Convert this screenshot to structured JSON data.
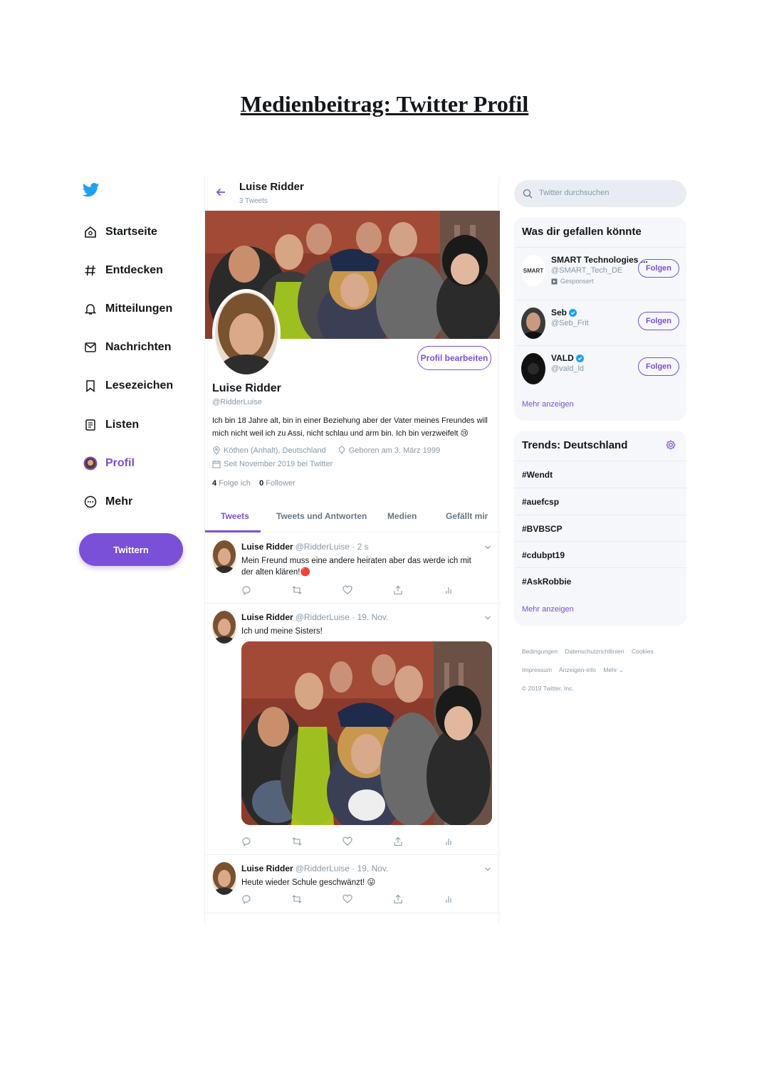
{
  "document": {
    "title": "Medienbeitrag: Twitter Profil"
  },
  "colors": {
    "accent": "#7b50d8",
    "twitter_blue": "#1da1f2",
    "muted": "#8899a6"
  },
  "sidebar": {
    "logo": "twitter-bird-icon",
    "items": [
      {
        "label": "Startseite",
        "icon": "home-icon"
      },
      {
        "label": "Entdecken",
        "icon": "hashtag-icon"
      },
      {
        "label": "Mitteilungen",
        "icon": "bell-icon"
      },
      {
        "label": "Nachrichten",
        "icon": "mail-icon"
      },
      {
        "label": "Lesezeichen",
        "icon": "bookmark-icon"
      },
      {
        "label": "Listen",
        "icon": "list-icon"
      },
      {
        "label": "Profil",
        "icon": "profile-avatar-icon",
        "active": true
      },
      {
        "label": "Mehr",
        "icon": "more-circle-icon"
      }
    ],
    "tweet_button": "Twittern"
  },
  "header": {
    "name": "Luise Ridder",
    "tweet_count": "3 Tweets"
  },
  "profile": {
    "name": "Luise Ridder",
    "handle": "@RidderLuise",
    "edit_button": "Profil bearbeiten",
    "bio": "Ich bin 18 Jahre alt, bin in einer Beziehung aber der Vater meines Freundes will mich nicht weil ich zu Assi, nicht schlau und arm bin. Ich bin verzweifelt 😢",
    "location": "Köthen (Anhalt), Deutschland",
    "birthday": "Geboren am 3. März 1999",
    "joined": "Seit November 2019 bei Twitter",
    "following_count": "4",
    "following_label": "Folge ich",
    "followers_count": "0",
    "followers_label": "Follower"
  },
  "tabs": [
    {
      "label": "Tweets",
      "active": true
    },
    {
      "label": "Tweets und Antworten"
    },
    {
      "label": "Medien"
    },
    {
      "label": "Gefällt mir"
    }
  ],
  "tweets": [
    {
      "name": "Luise Ridder",
      "meta": "@RidderLuise · 2 s",
      "text": "Mein Freund muss eine andere heiraten aber das werde ich mit der alten klären!🔴"
    },
    {
      "name": "Luise Ridder",
      "meta": "@RidderLuise · 19. Nov.",
      "text": "Ich und meine Sisters!",
      "has_media": true
    },
    {
      "name": "Luise Ridder",
      "meta": "@RidderLuise · 19. Nov.",
      "text": "Heute wieder Schule geschwänzt! 😛"
    }
  ],
  "search": {
    "placeholder": "Twitter durchsuchen"
  },
  "suggestions": {
    "title": "Was dir gefallen könnte",
    "items": [
      {
        "name": "SMART Technologies ...",
        "handle": "@SMART_Tech_DE",
        "sponsored": "Gesponsert",
        "button": "Folgen",
        "avatar_text": "SMART"
      },
      {
        "name": "Seb",
        "handle": "@Seb_Frit",
        "verified": true,
        "button": "Folgen"
      },
      {
        "name": "VALD",
        "handle": "@vald_ld",
        "verified": true,
        "button": "Folgen"
      }
    ],
    "more": "Mehr anzeigen"
  },
  "trends": {
    "title": "Trends: Deutschland",
    "items": [
      "#Wendt",
      "#auefcsp",
      "#BVBSCP",
      "#cdubpt19",
      "#AskRobbie"
    ],
    "more": "Mehr anzeigen"
  },
  "footer": {
    "links_row1": [
      "Bedingungen",
      "Datenschutzrichtlinien",
      "Cookies"
    ],
    "links_row2": [
      "Impressum",
      "Anzeigen-info",
      "Mehr ⌄"
    ],
    "copyright": "© 2019 Twitter, Inc."
  }
}
